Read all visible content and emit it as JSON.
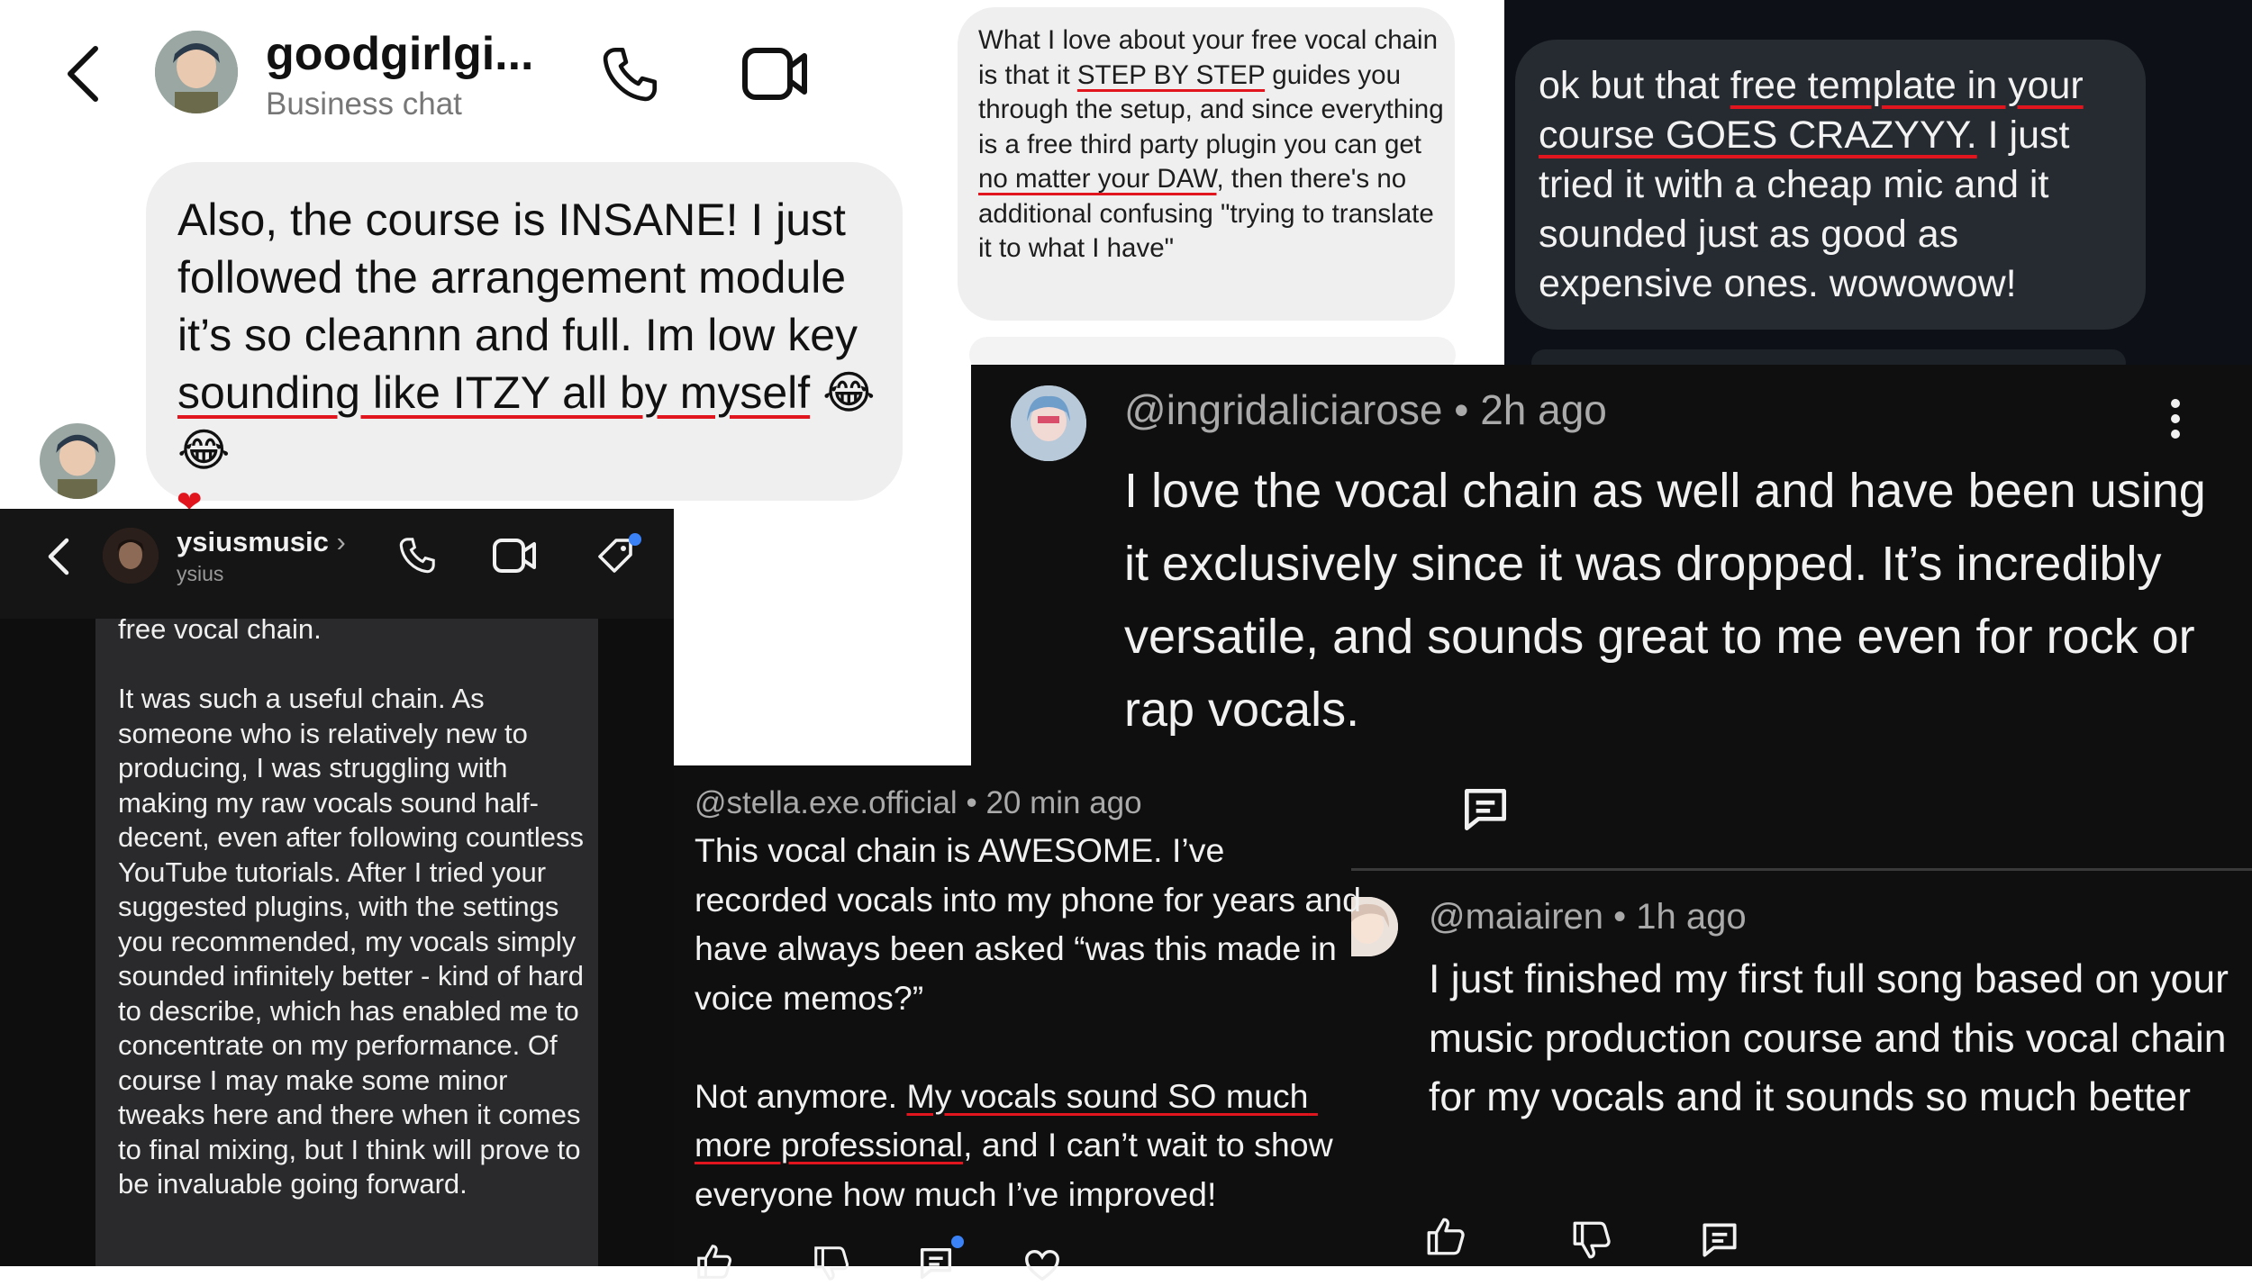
{
  "panel_a": {
    "username": "goodgirlgi...",
    "subtitle": "Business chat",
    "message": {
      "part1": "Also, the course is INSANE! I just followed the arrangement module it’s so cleannn and full. Im low key ",
      "highlight": "sounding like ITZY all by myself",
      "part2": " ",
      "emoji": "😂 😂"
    },
    "heart": "❤"
  },
  "panel_b": {
    "message": {
      "p1": "What I love about your free vocal chain is that it ",
      "h1": "STEP BY STEP",
      "p2": " guides you through the setup, and since everything is a free third party plugin you can get ",
      "h2": "no matter your DAW",
      "p3": ", then there's no additional confusing \"trying to translate it to what I have\""
    }
  },
  "panel_c": {
    "message": {
      "p1": "ok but that ",
      "h1": "free template in your course GOES CRAZYYY.",
      "p2": " I just tried it with a cheap mic and it sounded just as good as expensive ones. wowowow!"
    }
  },
  "panel_d": {
    "username": "ysiusmusic",
    "chevron": "›",
    "subtitle": "ysius",
    "message": "free vocal chain.\n\nIt was such a useful chain. As someone who is relatively new to producing, I was struggling with making my raw vocals sound half-decent, even after following countless YouTube tutorials. After I tried your suggested plugins, with the settings you recommended, my vocals simply sounded infinitely better - kind of hard to describe, which has enabled me to concentrate on my performance. Of course I may make some minor tweaks here and there when it comes to final mixing, but I think will prove to be invaluable going forward."
  },
  "panel_e": {
    "handle": "@ingridaliciarose",
    "sep": "•",
    "time": "2h ago",
    "message": "I love the vocal chain as well and have been using it exclusively since it was dropped. It’s incredibly versatile, and sounds great to me even for rock or rap vocals."
  },
  "panel_f": {
    "handle": "@stella.exe.official",
    "sep": "•",
    "time": "20 min ago",
    "message": {
      "p1": "This vocal chain is AWESOME. I’ve recorded vocals into my phone for years and have always been asked “was this made in voice memos?”\n\nNot anymore. ",
      "h1": "My vocals sound SO much more professional",
      "p2": ", and I can’t wait to show everyone how much I’ve improved!"
    }
  },
  "panel_g": {
    "handle": "@maiairen",
    "sep": "•",
    "time": "1h ago",
    "message": "I just finished my first full song based on your music production course and this vocal chain for my vocals and it sounds so much better"
  },
  "colors": {
    "underline": "#e0151e",
    "light_bubble": "#efefef",
    "dark_bg": "#0f0f0f",
    "dark_bubble": "#262a31",
    "blue_dot": "#3b82f6"
  }
}
